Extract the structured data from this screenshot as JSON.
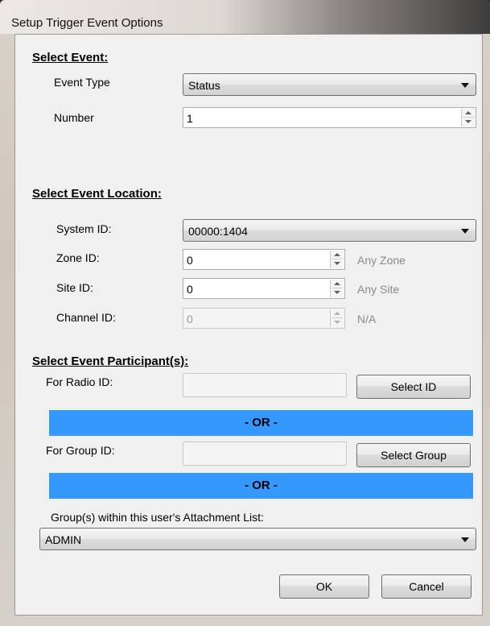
{
  "window": {
    "title": "Setup Trigger Event Options"
  },
  "select_event": {
    "heading": "Select Event:",
    "event_type_label": "Event Type",
    "event_type_value": "Status",
    "number_label": "Number",
    "number_value": "1"
  },
  "event_location": {
    "heading": "Select Event Location:",
    "system_id_label": "System ID:",
    "system_id_value": "00000:1404",
    "zone_id_label": "Zone ID:",
    "zone_id_value": "0",
    "zone_hint": "Any Zone",
    "site_id_label": "Site ID:",
    "site_id_value": "0",
    "site_hint": "Any Site",
    "channel_id_label": "Channel ID:",
    "channel_id_value": "0",
    "channel_hint": "N/A"
  },
  "participants": {
    "heading": "Select Event Participant(s):",
    "radio_id_label": "For Radio ID:",
    "radio_id_value": "",
    "select_id_button": "Select ID",
    "or_label_1": "- OR -",
    "group_id_label": "For Group ID:",
    "group_id_value": "",
    "select_group_button": "Select Group",
    "or_label_2": "- OR -",
    "attachment_list_label": "Group(s) within this user's Attachment List:",
    "attachment_list_value": "ADMIN"
  },
  "footer": {
    "ok_button": "OK",
    "cancel_button": "Cancel"
  },
  "colors": {
    "or_bar": "#3399ff",
    "disabled_text": "#8a8a8a"
  }
}
